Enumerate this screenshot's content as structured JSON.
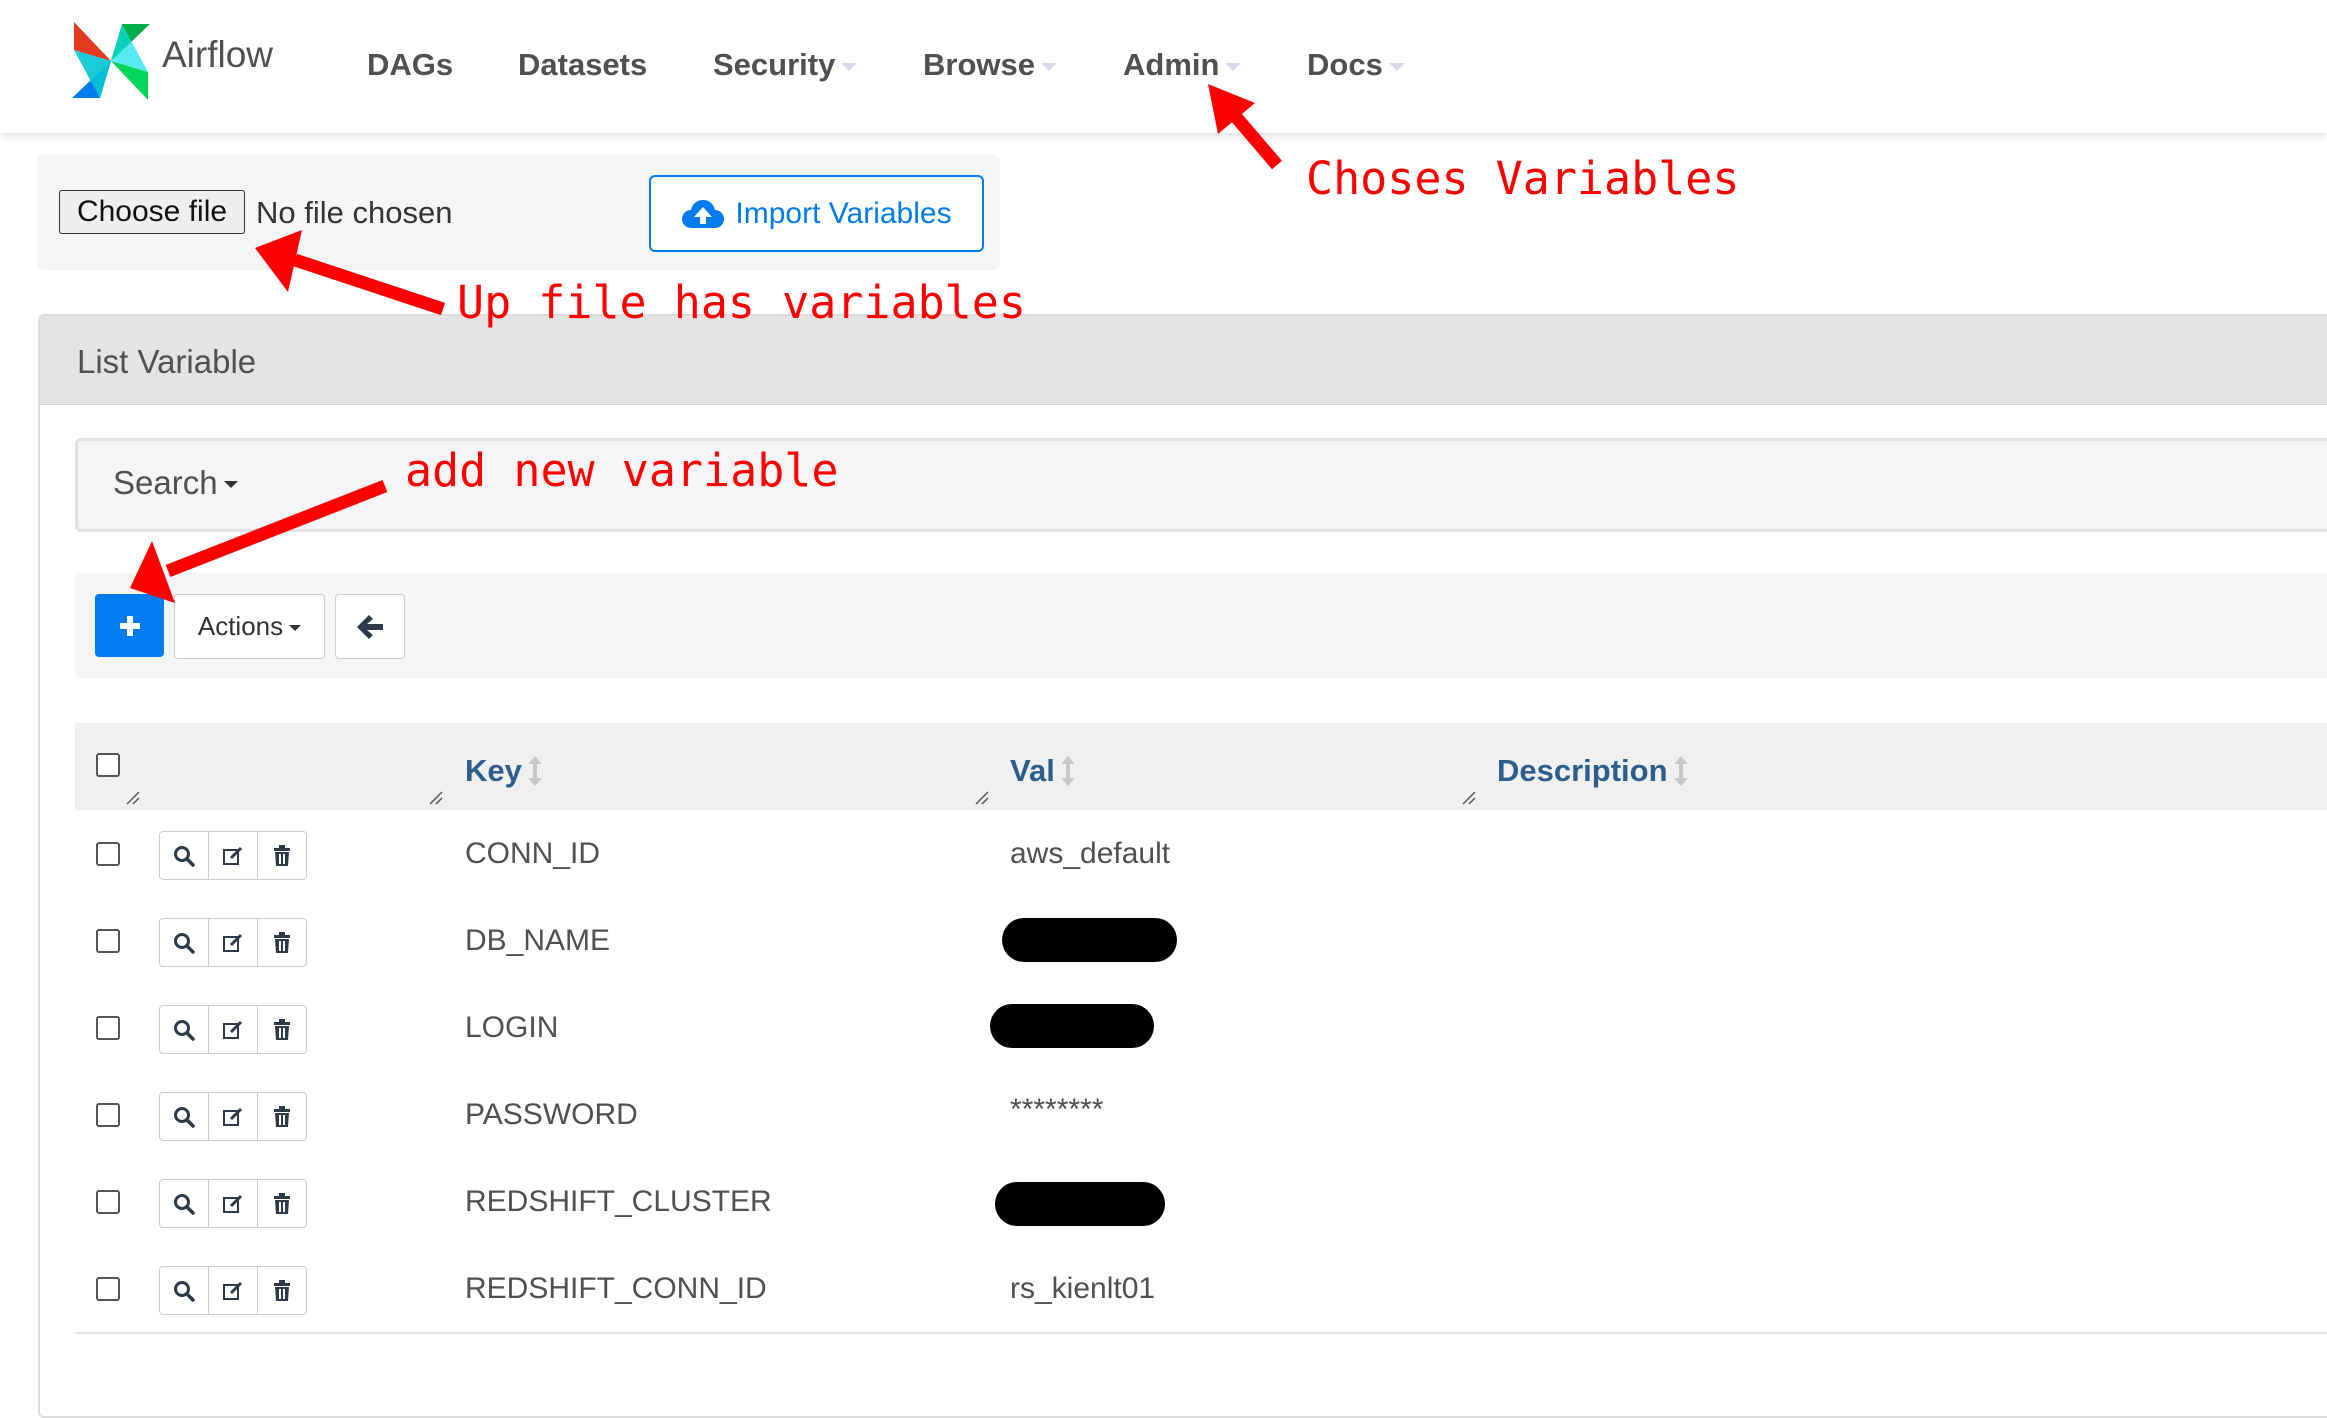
{
  "navbar": {
    "brand": "Airflow",
    "items": [
      {
        "label": "DAGs",
        "dropdown": false
      },
      {
        "label": "Datasets",
        "dropdown": false
      },
      {
        "label": "Security",
        "dropdown": true
      },
      {
        "label": "Browse",
        "dropdown": true
      },
      {
        "label": "Admin",
        "dropdown": true
      },
      {
        "label": "Docs",
        "dropdown": true
      }
    ]
  },
  "upload": {
    "choose_file": "Choose file",
    "no_file": "No file chosen",
    "import_label": "Import Variables"
  },
  "panel": {
    "title": "List Variable",
    "search_label": "Search",
    "actions_label": "Actions"
  },
  "table": {
    "headers": [
      "Key",
      "Val",
      "Description"
    ],
    "rows": [
      {
        "key": "CONN_ID",
        "val": "aws_default",
        "redacted": false
      },
      {
        "key": "DB_NAME",
        "val": "",
        "redacted": true
      },
      {
        "key": "LOGIN",
        "val": "",
        "redacted": true
      },
      {
        "key": "PASSWORD",
        "val": "********",
        "redacted": false
      },
      {
        "key": "REDSHIFT_CLUSTER",
        "val": "",
        "redacted": true
      },
      {
        "key": "REDSHIFT_CONN_ID",
        "val": "rs_kienlt01",
        "redacted": false
      }
    ]
  },
  "annotations": {
    "admin_note": "Choses Variables",
    "upload_note": "Up file has variables",
    "add_note": "add new variable"
  },
  "colors": {
    "primary": "#017cee",
    "header_link": "#2d5d8a",
    "annotation": "#ff0000"
  }
}
